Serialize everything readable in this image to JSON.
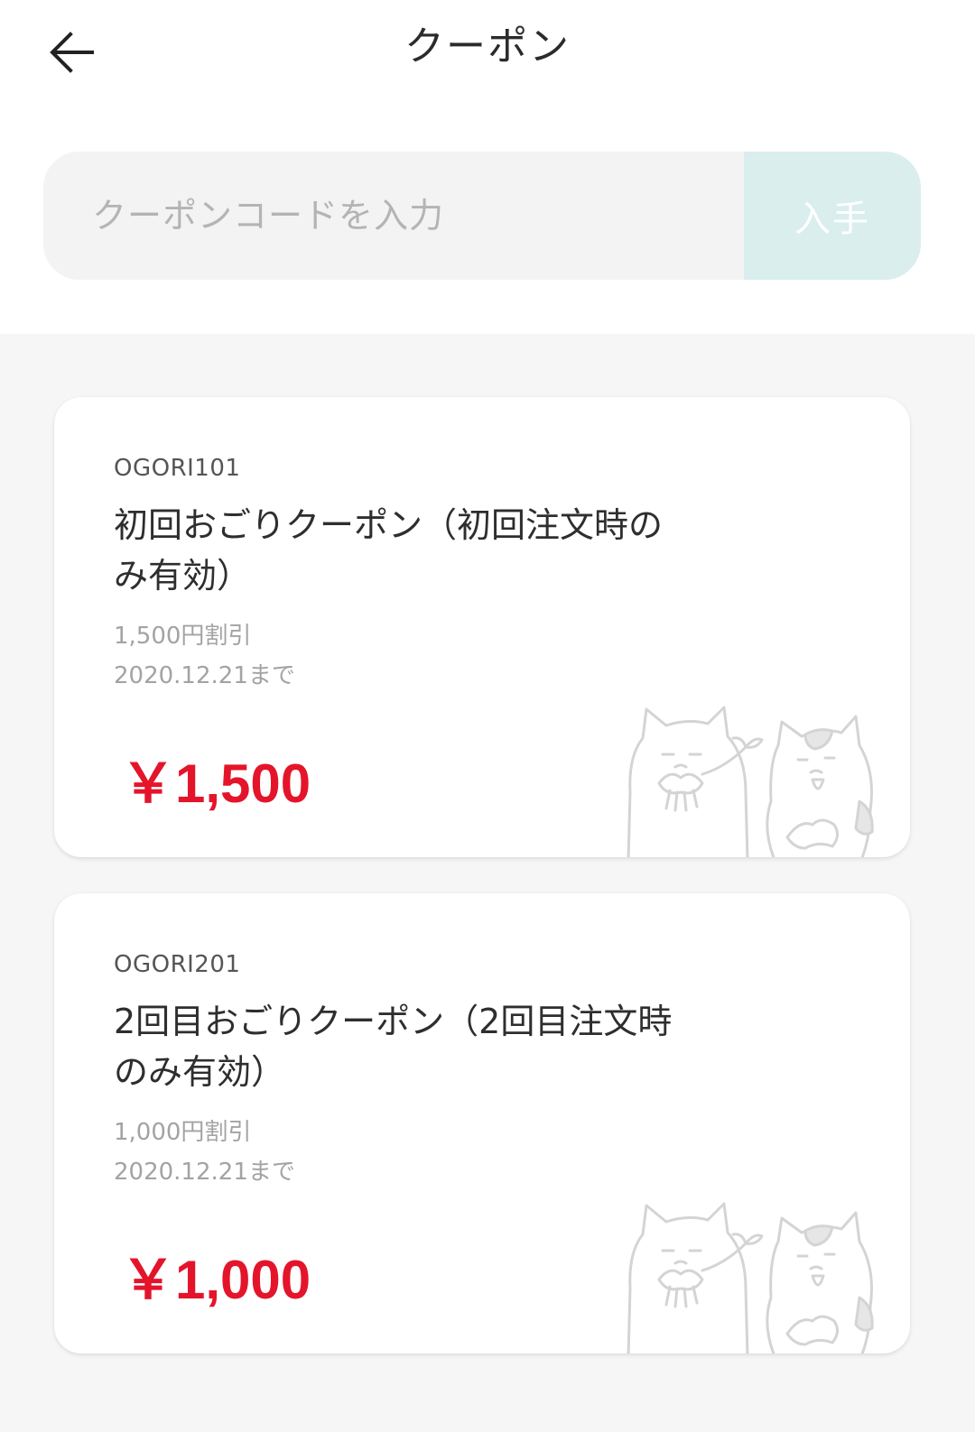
{
  "header": {
    "title": "クーポン"
  },
  "coupon_form": {
    "placeholder": "クーポンコードを入力",
    "value": "",
    "submit_label": "入手"
  },
  "coupons": [
    {
      "code": "OGORI101",
      "name": "初回おごりクーポン（初回注文時のみ有効）",
      "discount": "1,500円割引",
      "expiry": "2020.12.21まで",
      "amount": "￥1,500"
    },
    {
      "code": "OGORI201",
      "name": "2回目おごりクーポン（2回目注文時のみ有効）",
      "discount": "1,000円割引",
      "expiry": "2020.12.21まで",
      "amount": "￥1,000"
    }
  ],
  "colors": {
    "price": "#e4152b",
    "submit_button_bg": "#d9eeed",
    "page_bg": "#f6f6f6"
  },
  "icons": {
    "back": "arrow-left-icon",
    "card_illustration": "cats-illustration"
  }
}
